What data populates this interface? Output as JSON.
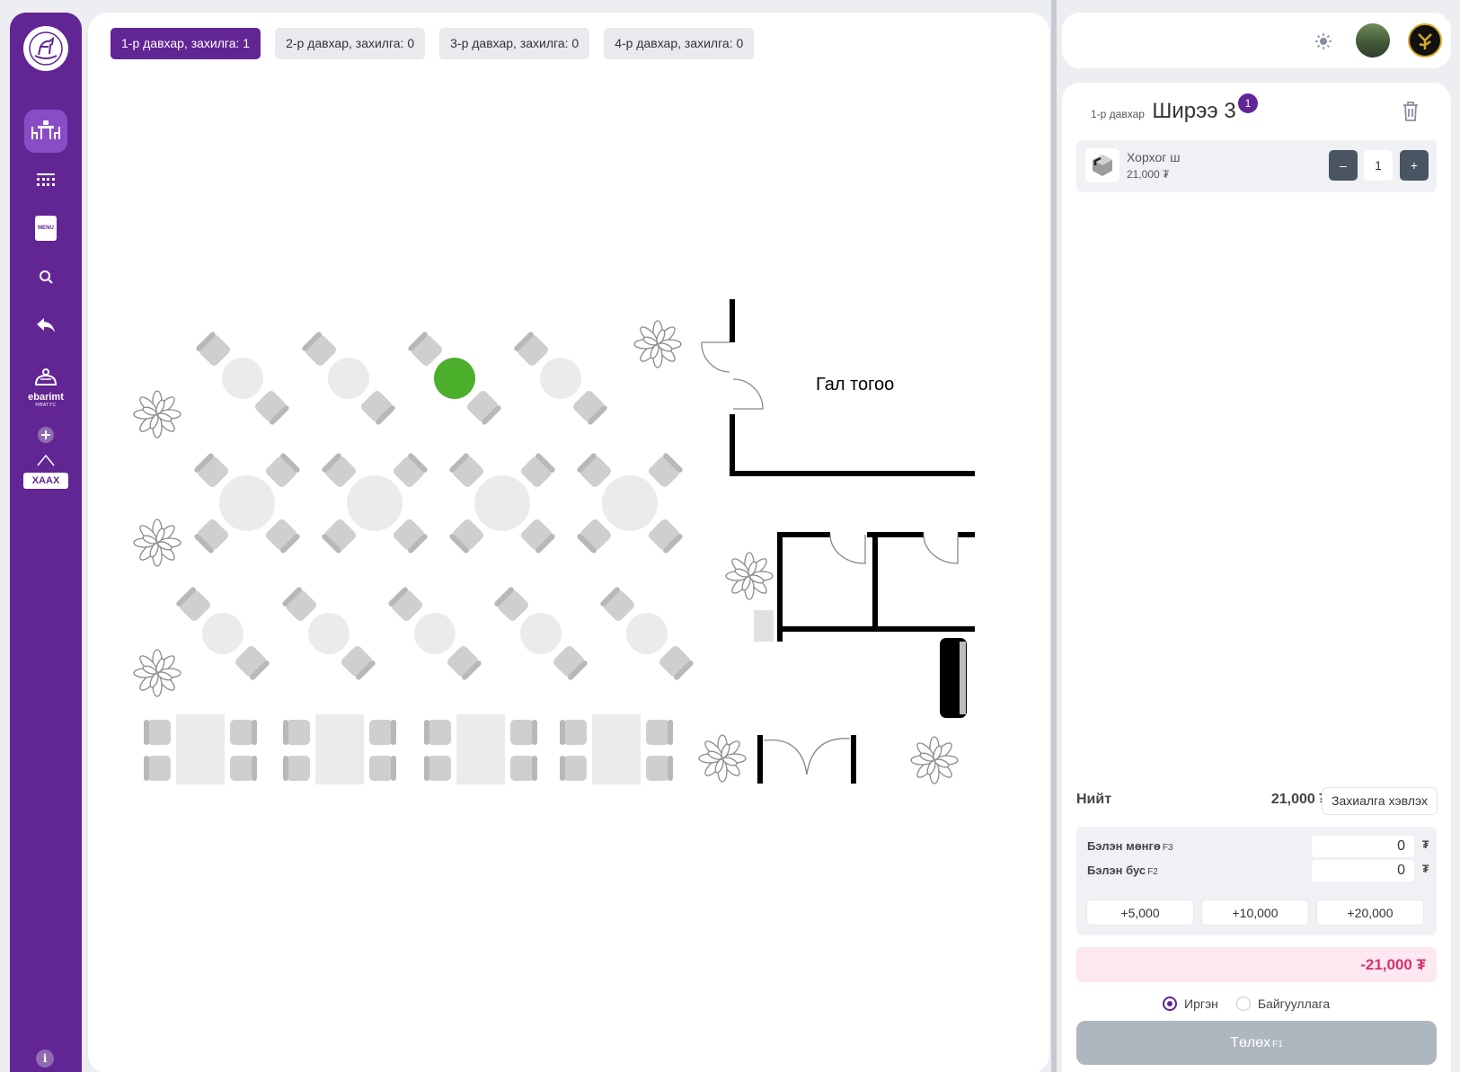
{
  "sidebar": {
    "ebarimt_label": "ebarimt",
    "ebarimt_sub": "НӨАТУС",
    "xaax_label": "ХААХ",
    "menu_icon_text": "MENU",
    "info_label": "i"
  },
  "floors": [
    {
      "label": "1-р давхар, захилга: 1",
      "active": true
    },
    {
      "label": "2-р давхар, захилга: 0",
      "active": false
    },
    {
      "label": "3-р давхар, захилга: 0",
      "active": false
    },
    {
      "label": "4-р давхар, захилга: 0",
      "active": false
    }
  ],
  "map": {
    "kitchen_label": "Гал тогоо",
    "occupied_color": "#4caf2c",
    "furniture_color": "#c8c8c8",
    "table_color": "#ebebeb"
  },
  "order": {
    "floor_label": "1-р давхар",
    "table_name": "Ширээ 3",
    "badge_count": "1",
    "items": [
      {
        "name": "Хорхог ш",
        "price": "21,000 ₮",
        "qty": "1",
        "minus": "–",
        "plus": "+"
      }
    ],
    "total_label": "Нийт",
    "total_value": "21,000 ₮",
    "print_button": "Захиалга хэвлэх",
    "cash_label": "Бэлэн мөнгө",
    "cash_key": "F3",
    "cash_value": "0",
    "noncash_label": "Бэлэн бус",
    "noncash_key": "F2",
    "noncash_value": "0",
    "currency": "₮",
    "quick_amounts": [
      "+5,000",
      "+10,000",
      "+20,000"
    ],
    "balance": "-21,000 ₮",
    "customer_types": [
      {
        "label": "Иргэн",
        "checked": true
      },
      {
        "label": "Байгууллага",
        "checked": false
      }
    ],
    "pay_button": "Төлөх",
    "pay_key": "F1"
  },
  "colors": {
    "brand": "#622594",
    "balance_bg": "#fde7f1",
    "balance_text": "#d6336c",
    "pay_disabled": "#aeb6bf"
  }
}
